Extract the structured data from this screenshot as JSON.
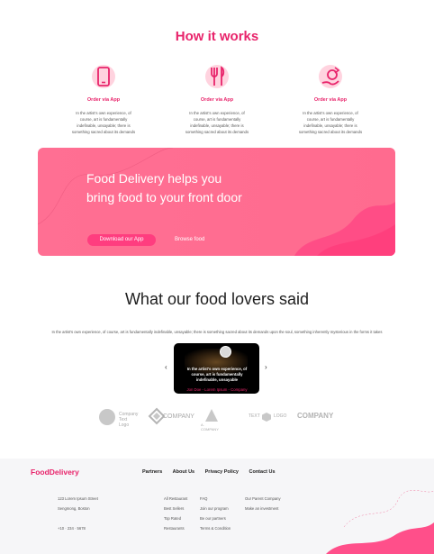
{
  "how_it_works": {
    "title": "How it works",
    "steps": [
      {
        "icon": "phone-icon",
        "title": "Order via App",
        "desc": [
          "In the artist's own experience, of",
          "course, art is fundamentally",
          "indefinable, unsayable; there is",
          "something sacred about its demands"
        ]
      },
      {
        "icon": "fork-knife-icon",
        "title": "Order via App",
        "desc": [
          "In the artist's own experience, of",
          "course, art is fundamentally",
          "indefinable, unsayable; there is",
          "something sacred about its demands"
        ]
      },
      {
        "icon": "hand-icon",
        "title": "Order via App",
        "desc": [
          "In the artist's own experience, of",
          "course, art is fundamentally",
          "indefinable, unsayable; there is",
          "something sacred about its demands"
        ]
      }
    ]
  },
  "banner": {
    "line1": "Food Delivery helps you",
    "line2": "bring food to your front door",
    "download_label": "Download our App",
    "browse_label": "Browse food"
  },
  "lovers": {
    "title": "What our food lovers said",
    "desc": "In the artist's own experience, of course, art is fundamentally indefinable, unsayable; there is something sacred about its demands upon the soul, something inherently mysterious in the forms it takes",
    "prev": "‹",
    "next": "›",
    "quote": [
      "In the artist's own experience, of",
      "course, art is fundamentally",
      "indefinable, unsayable"
    ],
    "name": "Jon Doe - Lorem Ipsum - Company"
  },
  "logos": [
    {
      "icon": "company-logo-circle-icon",
      "text": [
        "Company",
        "Text Logo"
      ]
    },
    {
      "icon": "company-logo-diamond-icon",
      "text": [
        "COMPANY"
      ]
    },
    {
      "icon": "company-logo-triangle-icon",
      "text": [
        "A. COMPANY"
      ]
    },
    {
      "icon": "company-logo-hexagon-icon",
      "text": [
        "TEXT",
        "LOGO"
      ]
    },
    {
      "icon": "company-logo-wordmark-icon",
      "text": [
        "COMPANY"
      ]
    }
  ],
  "footer": {
    "brand": "FoodDelivery",
    "nav": [
      "Partners",
      "About Us",
      "Privacy Policy",
      "Contact Us"
    ],
    "address": [
      "123 Lorem Ipsum Street",
      "Sengmong, Boston",
      "",
      "+10 · 234 · 5678"
    ],
    "col1": [
      "All Restaurant",
      "Best Sellers",
      "Top Rated",
      "Restaurants"
    ],
    "col2": [
      "FAQ",
      "Join our program",
      "Be our partners",
      "Terms & Condition"
    ],
    "col3": [
      "Our Parent Company",
      "Make an investment"
    ]
  },
  "colors": {
    "accent": "#e8246b",
    "banner": "#ff6f93",
    "button": "#ff3d7f"
  }
}
